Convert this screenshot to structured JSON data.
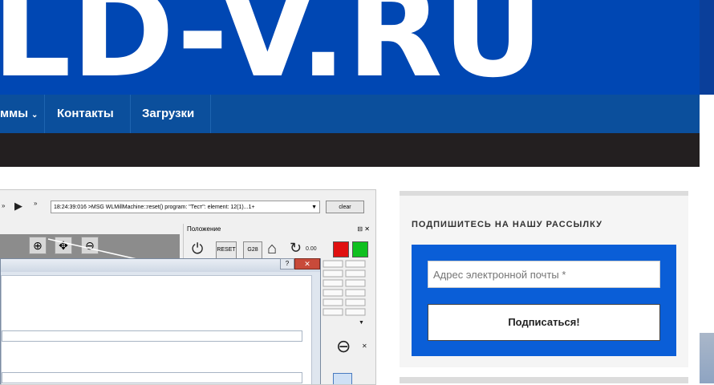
{
  "brand": {
    "logo_text": "LD-V.RU",
    "color": "#0047b3"
  },
  "nav": {
    "items": [
      {
        "label": "ммы",
        "has_dropdown": true
      },
      {
        "label": "Контакты"
      },
      {
        "label": "Загрузки"
      }
    ]
  },
  "screenshot": {
    "log_message": "18:24:39:016 >MSG WLMillMachine::reset() program: \"Тест\": element: 12(1)...1+",
    "clear_label": "clear",
    "panel_title": "Положение",
    "panel_controls": "⊟ ✕",
    "reset_label": "RESET",
    "g28_label": "G28",
    "feed_value": "0.00",
    "dialog_help": "?"
  },
  "newsletter": {
    "title": "ПОДПИШИТЕСЬ НА НАШУ РАССЫЛКУ",
    "email_placeholder": "Адрес электронной почты *",
    "subscribe_label": "Подписаться!"
  }
}
